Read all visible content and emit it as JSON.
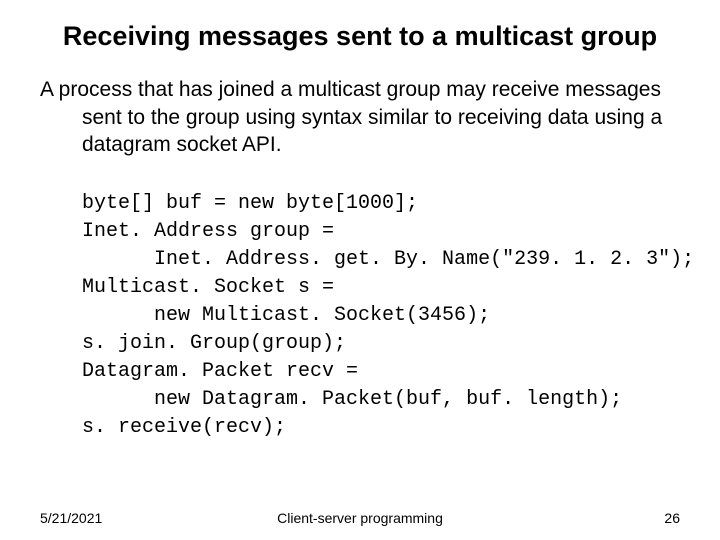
{
  "title": "Receiving messages sent to a multicast group",
  "paragraph": "A process that has joined a multicast group may receive messages sent to the group using syntax similar to receiving data using a datagram socket API.",
  "code_lines": [
    "byte[] buf = new byte[1000];",
    "Inet. Address group =",
    "      Inet. Address. get. By. Name(\"239. 1. 2. 3\");",
    "Multicast. Socket s =",
    "      new Multicast. Socket(3456);",
    "s. join. Group(group);",
    "Datagram. Packet recv =",
    "      new Datagram. Packet(buf, buf. length);",
    "s. receive(recv);"
  ],
  "footer": {
    "date": "5/21/2021",
    "center": "Client-server programming",
    "page": "26"
  }
}
